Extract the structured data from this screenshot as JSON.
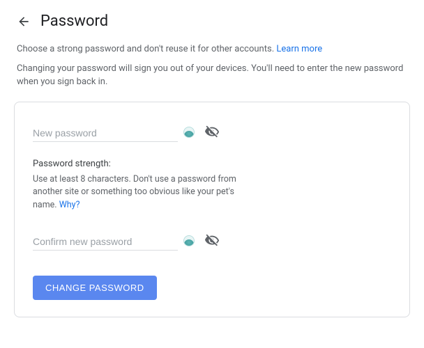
{
  "header": {
    "title": "Password"
  },
  "intro": {
    "line1": "Choose a strong password and don't reuse it for other accounts. ",
    "learn_more": "Learn more",
    "line2": "Changing your password will sign you out of your devices. You'll need to enter the new password when you sign back in."
  },
  "form": {
    "new_password_placeholder": "New password",
    "confirm_password_placeholder": "Confirm new password",
    "strength_title": "Password strength:",
    "strength_desc_pre": "Use at least 8 characters. Don't use a password from another site or something too obvious like your pet's name. ",
    "strength_why": "Why?",
    "button_label": "Change Password"
  },
  "icons": {
    "back": "back-arrow-icon",
    "visibility": "visibility-off-icon",
    "extension": "password-manager-icon"
  }
}
